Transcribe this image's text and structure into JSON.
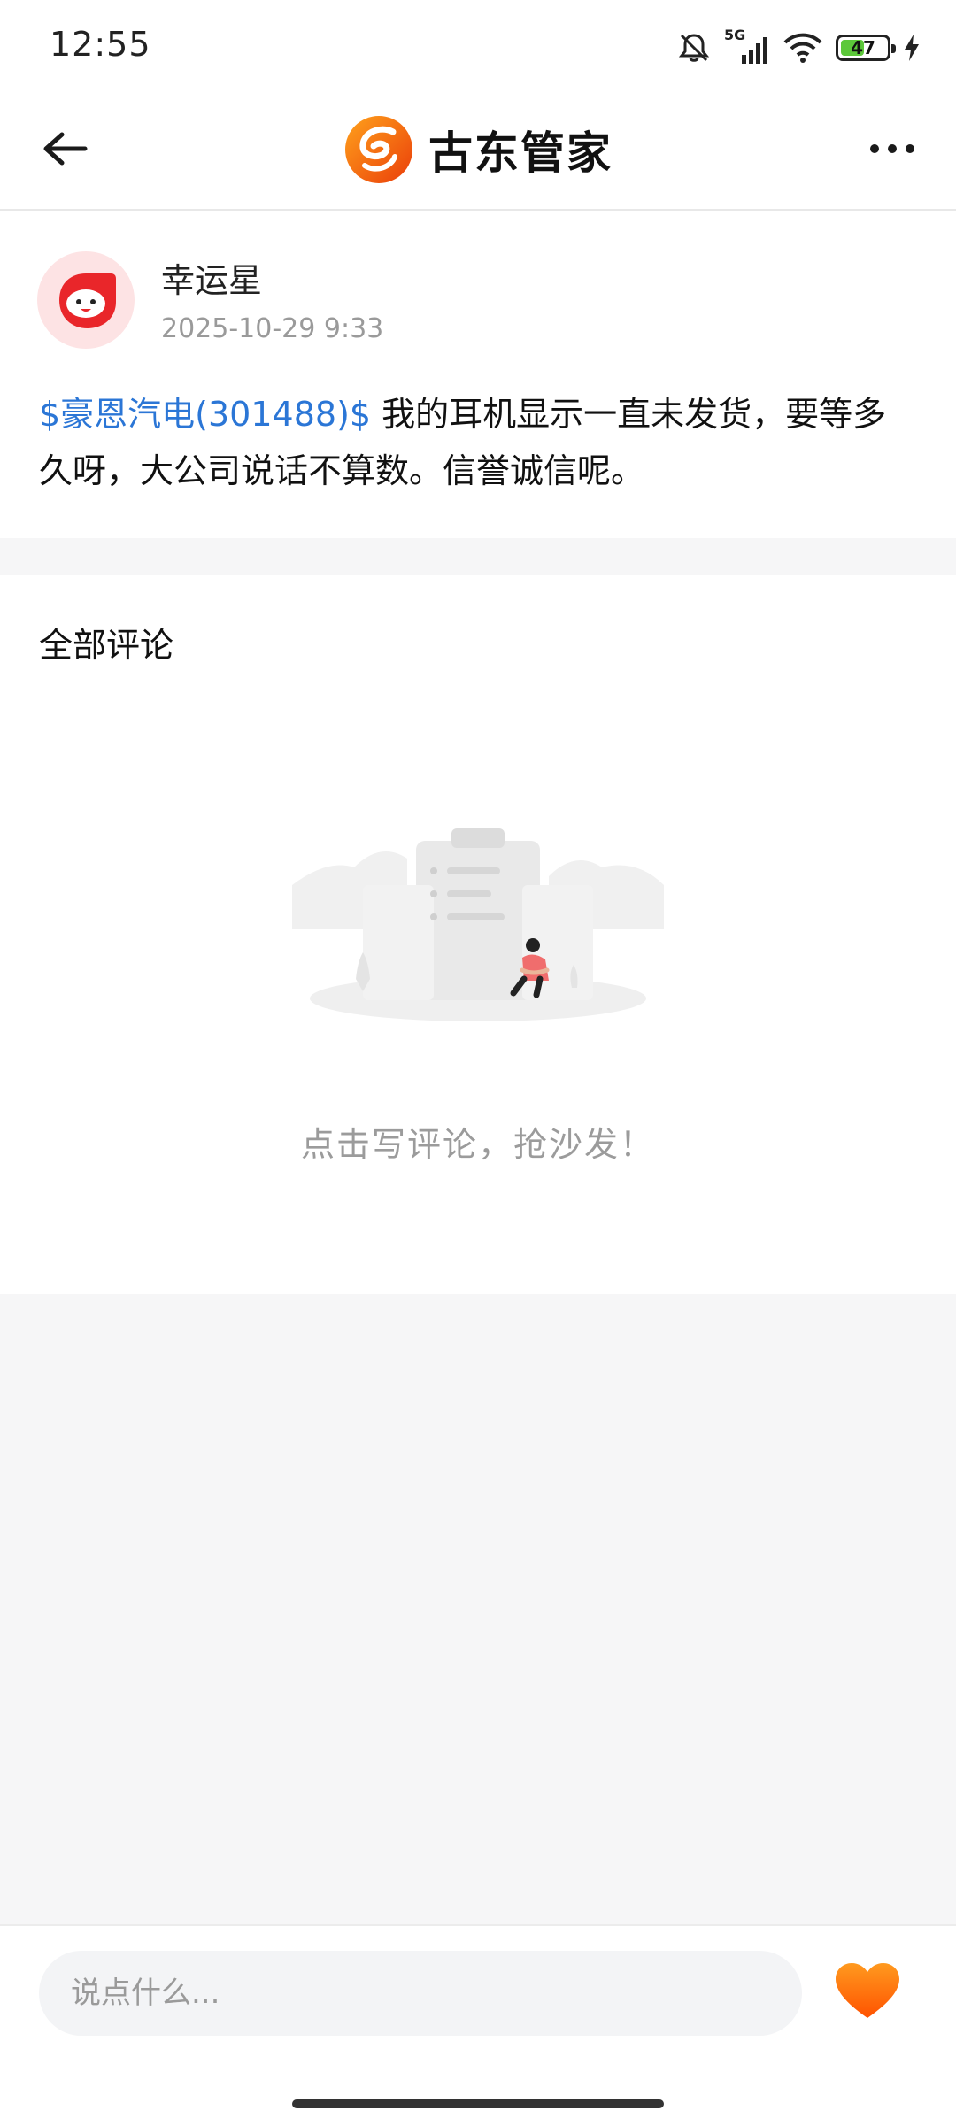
{
  "status": {
    "time": "12:55",
    "network": "5G",
    "battery": "47",
    "battery_level": 0.47
  },
  "header": {
    "brand_name": "古东管家",
    "icons": [
      "back-arrow-icon",
      "brand-logo-icon",
      "more-options-icon"
    ]
  },
  "post": {
    "username": "幸运星",
    "timestamp": "2025-10-29 9:33",
    "stock_tag": "$豪恩汽电(301488)$",
    "content": " 我的耳机显示一直未发货，要等多久呀，大公司说话不算数。信誉诚信呢。"
  },
  "comments": {
    "title": "全部评论",
    "empty_text": "点击写评论，抢沙发！"
  },
  "bottom_bar": {
    "input_placeholder": "说点什么...",
    "like_icon": "heart-icon"
  },
  "colors": {
    "accent_orange": "#ff6a00",
    "link_blue": "#2b76d6",
    "background": "#f6f6f7"
  }
}
